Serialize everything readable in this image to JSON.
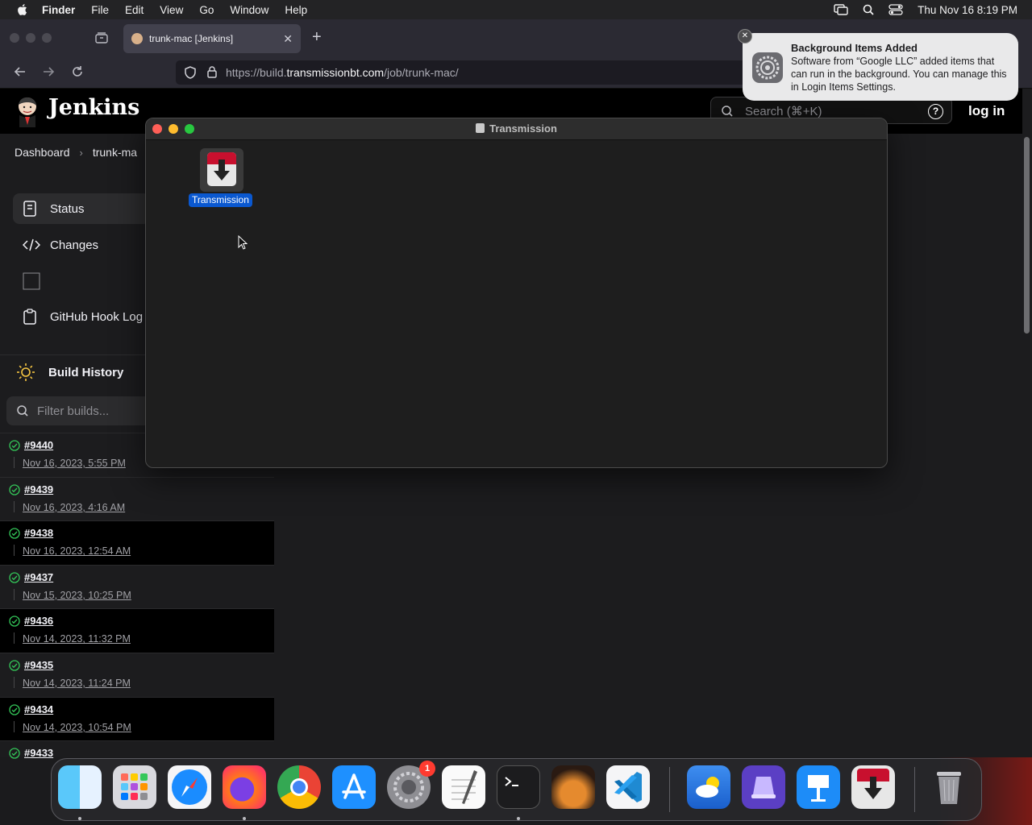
{
  "menubar": {
    "app": "Finder",
    "items": [
      "File",
      "Edit",
      "View",
      "Go",
      "Window",
      "Help"
    ],
    "datetime": "Thu Nov 16  8:19 PM"
  },
  "browser": {
    "tab_title": "trunk-mac [Jenkins]",
    "url_prefix": "https://build.",
    "url_host": "transmissionbt.com",
    "url_path": "/job/trunk-mac/"
  },
  "jenkins": {
    "title": "Jenkins",
    "search_placeholder": "Search (⌘+K)",
    "help": "?",
    "login": "log in",
    "breadcrumb": [
      "Dashboard",
      "trunk-ma"
    ],
    "sidebar": [
      {
        "label": "Status",
        "icon": "status-icon"
      },
      {
        "label": "Changes",
        "icon": "code-icon"
      },
      {
        "label": "",
        "icon": "empty-box-icon"
      },
      {
        "label": "GitHub Hook Log",
        "icon": "clipboard-icon"
      }
    ],
    "build_history_title": "Build History",
    "filter_placeholder": "Filter builds...",
    "builds": [
      {
        "num": "#9440",
        "date": "Nov 16, 2023, 5:55 PM"
      },
      {
        "num": "#9439",
        "date": "Nov 16, 2023, 4:16 AM"
      },
      {
        "num": "#9438",
        "date": "Nov 16, 2023, 12:54 AM"
      },
      {
        "num": "#9437",
        "date": "Nov 15, 2023, 10:25 PM"
      },
      {
        "num": "#9436",
        "date": "Nov 14, 2023, 11:32 PM"
      },
      {
        "num": "#9435",
        "date": "Nov 14, 2023, 11:24 PM"
      },
      {
        "num": "#9434",
        "date": "Nov 14, 2023, 10:54 PM"
      },
      {
        "num": "#9433",
        "date": ""
      }
    ]
  },
  "finder": {
    "window_title": "Transmission",
    "item_label": "Transmission"
  },
  "notification": {
    "title": "Background Items Added",
    "body": "Software from “Google LLC” added items that can run in the background. You can manage this in Login Items Settings."
  },
  "dock": {
    "apps": [
      "finder",
      "launchpad",
      "safari",
      "firefox",
      "chrome",
      "app-store",
      "system-settings",
      "textedit",
      "terminal",
      "garageband",
      "vscode",
      "weather",
      "notability",
      "keynote",
      "transmission",
      "trash"
    ],
    "settings_badge": "1"
  },
  "colors": {
    "accent": "#0a58d0",
    "success": "#34c759",
    "badge": "#ff3b30"
  }
}
